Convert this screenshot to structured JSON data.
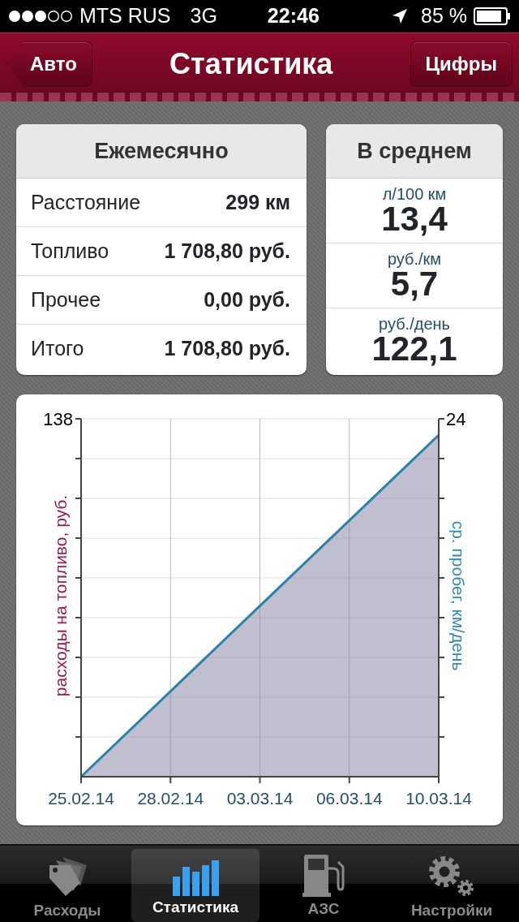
{
  "status_bar": {
    "carrier": "MTS RUS",
    "network": "3G",
    "time": "22:46",
    "battery": "85 %"
  },
  "nav": {
    "back_button": "Авто",
    "title": "Статистика",
    "right_button": "Цифры"
  },
  "monthly": {
    "title": "Ежемесячно",
    "rows": [
      {
        "label": "Расстояние",
        "value": "299 км"
      },
      {
        "label": "Топливо",
        "value": "1 708,80 руб."
      },
      {
        "label": "Прочее",
        "value": "0,00 руб."
      },
      {
        "label": "Итого",
        "value": "1 708,80 руб."
      }
    ]
  },
  "average": {
    "title": "В среднем",
    "items": [
      {
        "unit": "л/100 км",
        "value": "13,4"
      },
      {
        "unit": "руб./км",
        "value": "5,7"
      },
      {
        "unit": "руб./день",
        "value": "122,1"
      }
    ]
  },
  "chart": {
    "left_axis_label": "расходы на топливо, руб.",
    "left_max": "138",
    "right_axis_label": "ср. пробег, км/день",
    "right_max": "24",
    "x_labels": [
      "25.02.14",
      "28.02.14",
      "03.03.14",
      "06.03.14",
      "10.03.14"
    ]
  },
  "tabs": [
    {
      "label": "Расходы",
      "kind": "tags",
      "selected": false
    },
    {
      "label": "Статистика",
      "kind": "bars",
      "selected": true
    },
    {
      "label": "АЗС",
      "kind": "fuel",
      "selected": false
    },
    {
      "label": "Настройки",
      "kind": "gears",
      "selected": false
    }
  ]
}
